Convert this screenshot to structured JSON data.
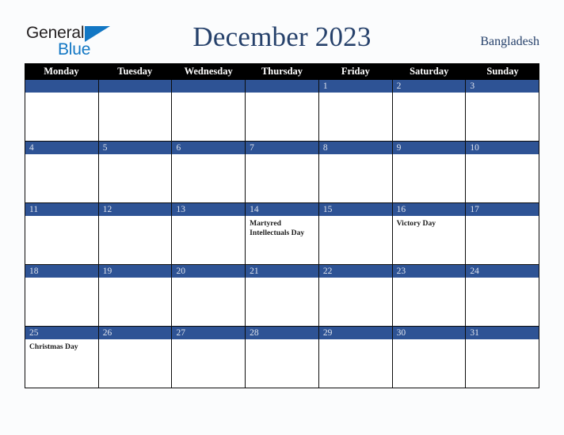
{
  "brand": {
    "line1": "General",
    "line2": "Blue",
    "triangle_color": "#1277c4"
  },
  "header": {
    "title": "December 2023",
    "country": "Bangladesh",
    "title_color": "#26416b"
  },
  "calendar": {
    "weekday_headers": [
      "Monday",
      "Tuesday",
      "Wednesday",
      "Thursday",
      "Friday",
      "Saturday",
      "Sunday"
    ],
    "header_bg": "#000000",
    "date_bar_color": "#2e5395",
    "weeks": [
      [
        {
          "date": "",
          "events": []
        },
        {
          "date": "",
          "events": []
        },
        {
          "date": "",
          "events": []
        },
        {
          "date": "",
          "events": []
        },
        {
          "date": "1",
          "events": []
        },
        {
          "date": "2",
          "events": []
        },
        {
          "date": "3",
          "events": []
        }
      ],
      [
        {
          "date": "4",
          "events": []
        },
        {
          "date": "5",
          "events": []
        },
        {
          "date": "6",
          "events": []
        },
        {
          "date": "7",
          "events": []
        },
        {
          "date": "8",
          "events": []
        },
        {
          "date": "9",
          "events": []
        },
        {
          "date": "10",
          "events": []
        }
      ],
      [
        {
          "date": "11",
          "events": []
        },
        {
          "date": "12",
          "events": []
        },
        {
          "date": "13",
          "events": []
        },
        {
          "date": "14",
          "events": [
            "Martyred Intellectuals Day"
          ]
        },
        {
          "date": "15",
          "events": []
        },
        {
          "date": "16",
          "events": [
            "Victory Day"
          ]
        },
        {
          "date": "17",
          "events": []
        }
      ],
      [
        {
          "date": "18",
          "events": []
        },
        {
          "date": "19",
          "events": []
        },
        {
          "date": "20",
          "events": []
        },
        {
          "date": "21",
          "events": []
        },
        {
          "date": "22",
          "events": []
        },
        {
          "date": "23",
          "events": []
        },
        {
          "date": "24",
          "events": []
        }
      ],
      [
        {
          "date": "25",
          "events": [
            "Christmas Day"
          ]
        },
        {
          "date": "26",
          "events": []
        },
        {
          "date": "27",
          "events": []
        },
        {
          "date": "28",
          "events": []
        },
        {
          "date": "29",
          "events": []
        },
        {
          "date": "30",
          "events": []
        },
        {
          "date": "31",
          "events": []
        }
      ]
    ]
  }
}
